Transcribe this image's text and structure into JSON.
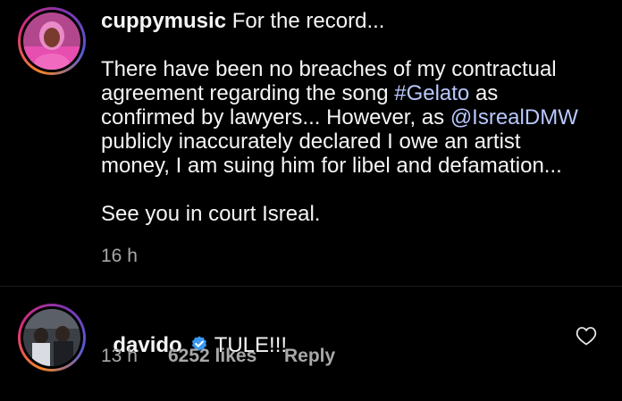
{
  "post": {
    "username": "cuppymusic",
    "caption_first": " For the record...",
    "para1": {
      "l1": "There have been no breaches of my contractual",
      "l2_prefix": "agreement regarding the song ",
      "l2_hashtag": "#Gelato",
      "l2_suffix": " as",
      "l3_prefix": "confirmed by lawyers... However, as ",
      "l3_mention": "@IsrealDMW",
      "l4": "publicly inaccurately declared I owe an artist",
      "l5": "money, I am suing him for libel and defamation..."
    },
    "para2": "See you in court Isreal.",
    "time": "16 h"
  },
  "comment": {
    "username": "davido",
    "text": "TULE!!!",
    "time": "13 h",
    "likes": "6252 likes",
    "reply_label": "Reply"
  },
  "icons": {
    "verified": "verified-badge-icon",
    "like": "heart-outline-icon"
  },
  "colors": {
    "background": "#000000",
    "text": "#f5f5f5",
    "muted": "#a8a8a8",
    "link": "#b9c8ff",
    "verified": "#3897f0"
  }
}
